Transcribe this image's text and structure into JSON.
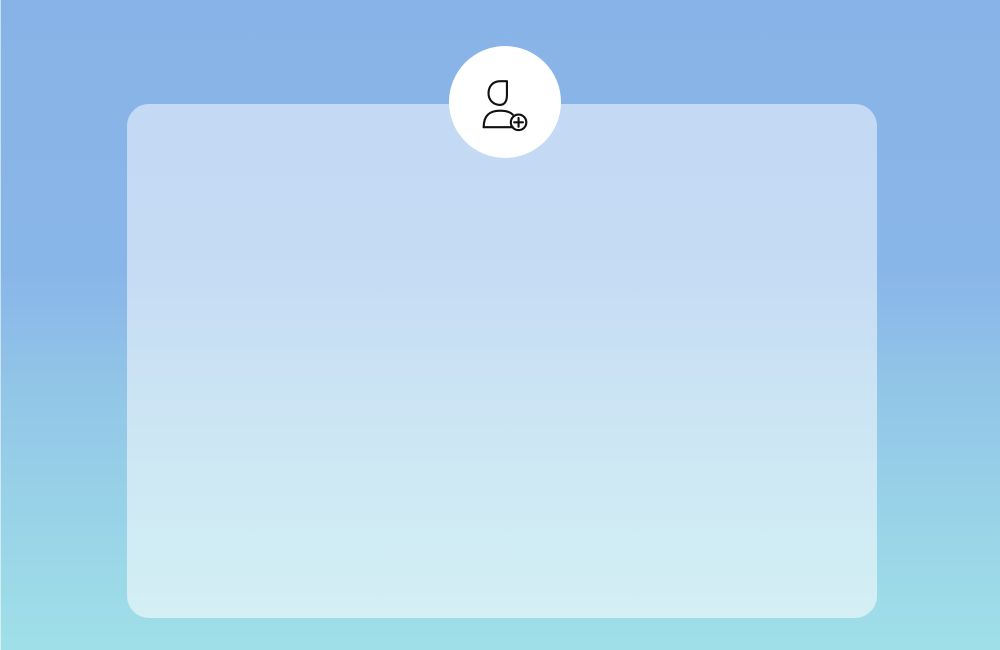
{
  "window": {
    "title": ""
  },
  "icons": {
    "avatar": "add-user-icon"
  },
  "colors": {
    "background_top": "#88b3e8",
    "background_bottom": "#9fe0e8",
    "card": "rgba(255,255,255,0.52)",
    "avatar_bg": "#ffffff",
    "icon_stroke": "#111111"
  }
}
